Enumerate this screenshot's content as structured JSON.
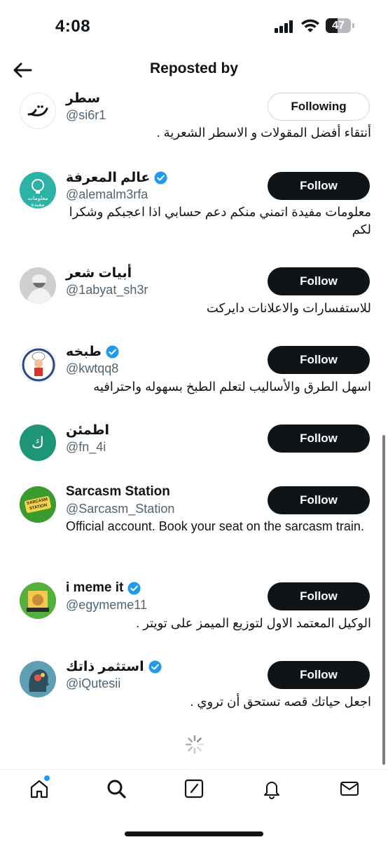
{
  "status_bar": {
    "time": "4:08",
    "battery": "47",
    "battery_level_percent": 47
  },
  "header": {
    "title": "Reposted by",
    "back_icon": "arrow-left-icon"
  },
  "colors": {
    "accent": "#1d9bf0",
    "primary_button": "#0f1419",
    "secondary_text": "#536471"
  },
  "users": [
    {
      "name": "سطر",
      "handle": "@si6r1",
      "verified": false,
      "button": "Following",
      "bio": "أنتقاء أفضل المقولات و الاسطر الشعرية ."
    },
    {
      "name": "عالم المعرفة",
      "handle": "@alemalm3rfa",
      "verified": true,
      "button": "Follow",
      "bio": "معلومات مفيدة اتمني منكم دعم حسابي اذا اعجبكم وشكرا لكم",
      "avatar_text": "معلومات مفيدة"
    },
    {
      "name": "أبيات شعر",
      "handle": "@1abyat_sh3r",
      "verified": false,
      "button": "Follow",
      "bio": "للاستفسارات والاعلانات دايركت"
    },
    {
      "name": "طبخه",
      "handle": "@kwtqq8",
      "verified": true,
      "button": "Follow",
      "bio": "اسهل الطرق والأساليب لتعلم الطبخ بسهوله واحترافيه"
    },
    {
      "name": "اطمئن",
      "handle": "@fn_4i",
      "verified": false,
      "button": "Follow",
      "bio": "",
      "avatar_text": "ك"
    },
    {
      "name": "Sarcasm Station",
      "handle": "@Sarcasm_Station",
      "verified": false,
      "button": "Follow",
      "bio": "Official account. Book your seat on the sarcasm train.",
      "avatar_text": "SARCASM STATION"
    },
    {
      "name": "i meme it",
      "handle": "@egymeme11",
      "verified": true,
      "button": "Follow",
      "bio": "الوكيل المعتمد الاول لتوزيع الميمز على تويتر ."
    },
    {
      "name": "استثمر ذاتك",
      "handle": "@iQutesii",
      "verified": true,
      "button": "Follow",
      "bio": "اجعل حياتك قصه تستحق أن تروي ."
    }
  ],
  "tab_bar": {
    "tabs": [
      "home-icon",
      "search-icon",
      "compose-icon",
      "notifications-icon",
      "messages-icon"
    ],
    "home_has_badge": true
  }
}
